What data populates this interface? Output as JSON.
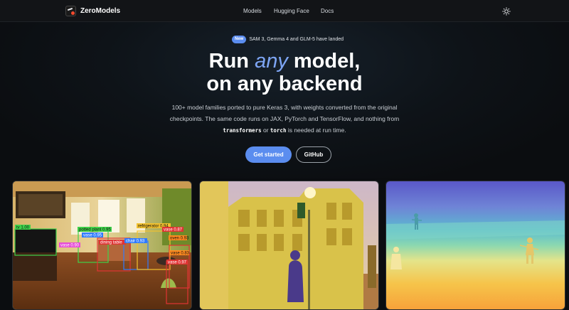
{
  "nav": {
    "brand": "ZeroModels",
    "links": [
      "Models",
      "Hugging Face",
      "Docs"
    ],
    "theme_icon": "sun-icon"
  },
  "hero": {
    "badge": "New",
    "announcement": "SAM 3, Gemma 4 and GLM-5 have landed",
    "headline_before": "Run ",
    "headline_emphasis": "any",
    "headline_after": " model,",
    "headline_line2": "on any backend",
    "subtext_1": "100+ model families ported to pure Keras 3, with weights converted from the original checkpoints. The same code runs on JAX, PyTorch and TensorFlow, and nothing from ",
    "code_1": "transformers",
    "subtext_2": " or ",
    "code_2": "torch",
    "subtext_3": " is needed at run time.",
    "primary_button": "Get started",
    "secondary_button": "GitHub",
    "accent_color": "#5b8def"
  },
  "showcase": {
    "detections": [
      {
        "label": "tv 1.00",
        "color": "#3fd24a"
      },
      {
        "label": "potted plant 0.95",
        "color": "#3fd24a"
      },
      {
        "label": "vase 0.95",
        "color": "#2f7bff"
      },
      {
        "label": "refrigerator 0.94",
        "color": "#f2c12e"
      },
      {
        "label": "vase 0.90",
        "color": "#e64bd6"
      },
      {
        "label": "dining table",
        "color": "#e03434"
      },
      {
        "label": "chair 0.93",
        "color": "#2f7bff"
      },
      {
        "label": "oven 0.93",
        "color": "#ff8a1f"
      },
      {
        "label": "vase 0.97",
        "color": "#e03434"
      },
      {
        "label": "vase 0.87",
        "color": "#e03434"
      },
      {
        "label": "vase 0.83",
        "color": "#ff8a1f"
      }
    ]
  }
}
